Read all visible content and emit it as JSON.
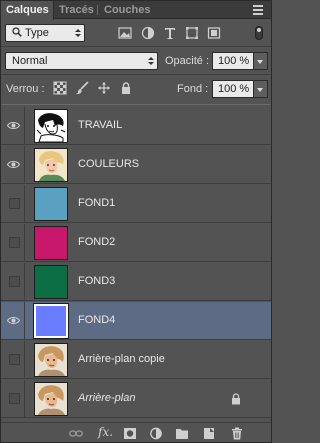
{
  "tabs": [
    {
      "label": "Calques",
      "active": true
    },
    {
      "label": "Tracés",
      "active": false
    },
    {
      "label": "Couches",
      "active": false
    }
  ],
  "filter": {
    "kind_value": "Type",
    "icons": [
      "image-filter-icon",
      "adjustment-filter-icon",
      "type-filter-icon",
      "shape-filter-icon",
      "smart-object-filter-icon"
    ]
  },
  "blend": {
    "mode": "Normal",
    "opacity_label": "Opacité :",
    "opacity_value": "100 %"
  },
  "lock": {
    "label": "Verrou :",
    "icons": [
      "lock-transparent-pixels-icon",
      "lock-image-pixels-icon",
      "lock-position-icon",
      "lock-all-icon"
    ],
    "fill_label": "Fond :",
    "fill_value": "100 %"
  },
  "layers": [
    {
      "name": "TRAVAIL",
      "visible": true,
      "thumb": "sketch",
      "selected": false,
      "italic": false,
      "locked": false
    },
    {
      "name": "COULEURS",
      "visible": true,
      "thumb": "portrait-color",
      "selected": false,
      "italic": false,
      "locked": false
    },
    {
      "name": "FOND1",
      "visible": false,
      "thumb": "solid",
      "color": "#5aa0c0",
      "selected": false,
      "italic": false,
      "locked": false
    },
    {
      "name": "FOND2",
      "visible": false,
      "thumb": "solid",
      "color": "#c8186c",
      "selected": false,
      "italic": false,
      "locked": false
    },
    {
      "name": "FOND3",
      "visible": false,
      "thumb": "solid",
      "color": "#0c6e44",
      "selected": false,
      "italic": false,
      "locked": false
    },
    {
      "name": "FOND4",
      "visible": true,
      "thumb": "solid",
      "color": "#6a7cff",
      "selected": true,
      "italic": false,
      "locked": false
    },
    {
      "name": "Arrière-plan copie",
      "visible": false,
      "thumb": "photo",
      "selected": false,
      "italic": false,
      "locked": false
    },
    {
      "name": "Arrière-plan",
      "visible": false,
      "thumb": "photo",
      "selected": false,
      "italic": true,
      "locked": true
    }
  ],
  "bottom_bar": [
    "link-layers-icon",
    "fx-icon",
    "layer-mask-icon",
    "adjustment-layer-icon",
    "new-group-icon",
    "new-layer-icon",
    "delete-layer-icon"
  ],
  "colors": {
    "panel_bg": "#535353",
    "selected_row": "#5d6c84",
    "tab_bar": "#3b3b3b"
  }
}
